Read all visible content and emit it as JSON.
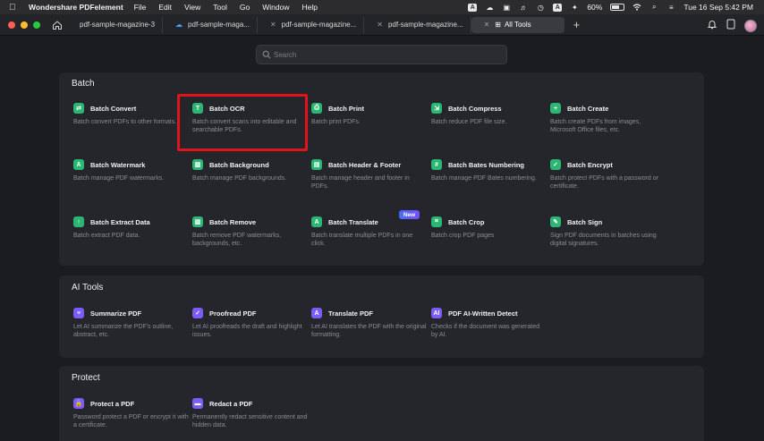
{
  "menubar": {
    "app_name": "Wondershare PDFelement",
    "menus": [
      "File",
      "Edit",
      "View",
      "Tool",
      "Go",
      "Window",
      "Help"
    ],
    "battery": "60%",
    "keyboard_badge": "A",
    "datetime": "Tue 16 Sep  5:42 PM"
  },
  "tabs": [
    {
      "label": "pdf-sample-magazine-3"
    },
    {
      "label": "pdf-sample-maga..."
    },
    {
      "label": "pdf-sample-magazine..."
    },
    {
      "label": "pdf-sample-magazine..."
    },
    {
      "label": "All Tools"
    }
  ],
  "search": {
    "placeholder": "Search"
  },
  "sections": {
    "batch": {
      "title": "Batch",
      "tools": [
        {
          "name": "Batch Convert",
          "desc": "Batch convert PDFs to other formats.",
          "icon": "batch-convert-icon"
        },
        {
          "name": "Batch OCR",
          "desc": "Batch convert scans into editable and searchable PDFs.",
          "icon": "ocr-icon"
        },
        {
          "name": "Batch Print",
          "desc": "Batch print PDFs.",
          "icon": "printer-icon"
        },
        {
          "name": "Batch Compress",
          "desc": "Batch reduce PDF file size.",
          "icon": "compress-icon"
        },
        {
          "name": "Batch Create",
          "desc": "Batch create PDFs from images, Microsoft Office files, etc.",
          "icon": "create-plus-icon"
        },
        {
          "name": "Batch Watermark",
          "desc": "Batch manage PDF watermarks.",
          "icon": "watermark-icon"
        },
        {
          "name": "Batch Background",
          "desc": "Batch manage PDF backgrounds.",
          "icon": "background-icon"
        },
        {
          "name": "Batch Header & Footer",
          "desc": "Batch manage header and footer in PDFs.",
          "icon": "header-footer-icon"
        },
        {
          "name": "Batch Bates Numbering",
          "desc": "Batch manage PDF Bates numbering.",
          "icon": "hash-icon"
        },
        {
          "name": "Batch Encrypt",
          "desc": "Batch protect PDFs with a password or certificate.",
          "icon": "shield-check-icon"
        },
        {
          "name": "Batch Extract Data",
          "desc": "Batch extract PDF data.",
          "icon": "extract-arrow-icon"
        },
        {
          "name": "Batch Remove",
          "desc": "Batch remove PDF watermarks, backgrounds, etc.",
          "icon": "remove-icon"
        },
        {
          "name": "Batch Translate",
          "desc": "Batch translate multiple PDFs in one click.",
          "icon": "translate-icon",
          "badge": "New"
        },
        {
          "name": "Batch Crop",
          "desc": "Batch crop PDF pages",
          "icon": "crop-icon"
        },
        {
          "name": "Batch Sign",
          "desc": "Sign PDF documents in batches using digital signatures.",
          "icon": "sign-icon"
        }
      ]
    },
    "ai": {
      "title": "AI Tools",
      "tools": [
        {
          "name": "Summarize PDF",
          "desc": "Let AI summarize the PDF's outline, abstract, etc.",
          "icon": "summarize-icon"
        },
        {
          "name": "Proofread PDF",
          "desc": "Let AI proofreads the draft and highlight issues.",
          "icon": "proofread-icon"
        },
        {
          "name": "Translate PDF",
          "desc": "Let AI translates the PDF with the original formatting.",
          "icon": "ai-translate-icon"
        },
        {
          "name": "PDF AI-Written Detect",
          "desc": "Checks if the document was generated by AI.",
          "icon": "ai-detect-icon"
        }
      ]
    },
    "protect": {
      "title": "Protect",
      "tools": [
        {
          "name": "Protect a PDF",
          "desc": "Password protect a PDF or encrypt it with a certificate.",
          "icon": "lock-icon"
        },
        {
          "name": "Redact a PDF",
          "desc": "Permanently redact sensitive content and hidden data.",
          "icon": "redact-icon"
        }
      ]
    }
  },
  "colors": {
    "batch_green": "#2bb673",
    "ai_purple": "#7b5cf6",
    "highlight_red": "#e0141c"
  }
}
